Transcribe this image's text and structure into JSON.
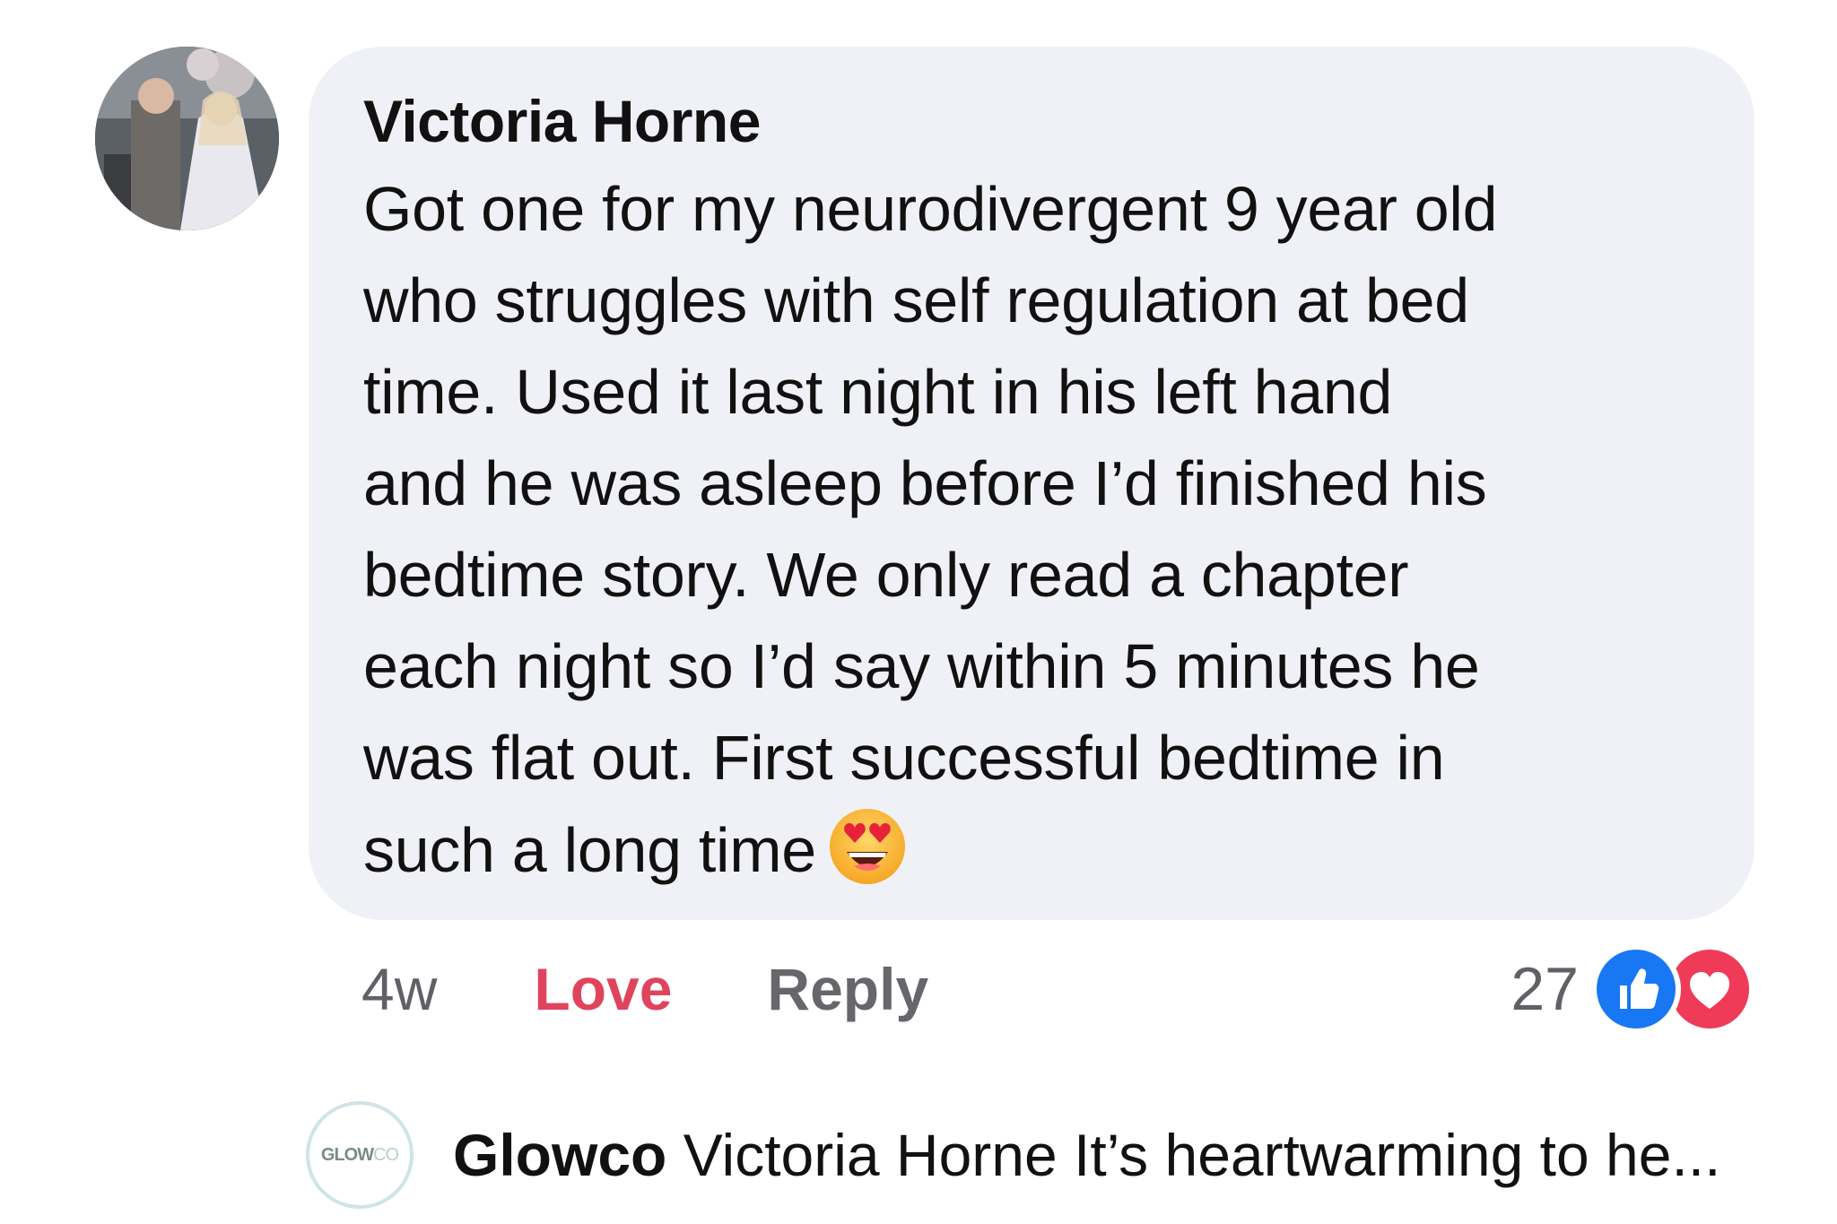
{
  "comment": {
    "author": "Victoria Horne",
    "lines": [
      "Got one for my neurodivergent 9 year old",
      "who struggles with self regulation at bed",
      "time. Used it last night in his left hand",
      "and he was asleep before I’d finished his",
      "bedtime story. We only read a chapter",
      "each night so I’d say within 5 minutes he",
      "was flat out. First successful bedtime in",
      "such a long time"
    ],
    "emoji": "smiling-face-with-heart-eyes"
  },
  "actions": {
    "time": "4w",
    "love": "Love",
    "reply": "Reply"
  },
  "reactions": {
    "count": "27",
    "types": [
      "like-icon",
      "heart-icon"
    ],
    "like_color": "#1877f2",
    "heart_color": "#ef3b57",
    "love_label_color": "#e0445d"
  },
  "reply": {
    "avatar_logo_main": "GLOW",
    "avatar_logo_suffix": "CO",
    "author": "Glowco",
    "preview": "Victoria Horne It’s heartwarming to he..."
  }
}
